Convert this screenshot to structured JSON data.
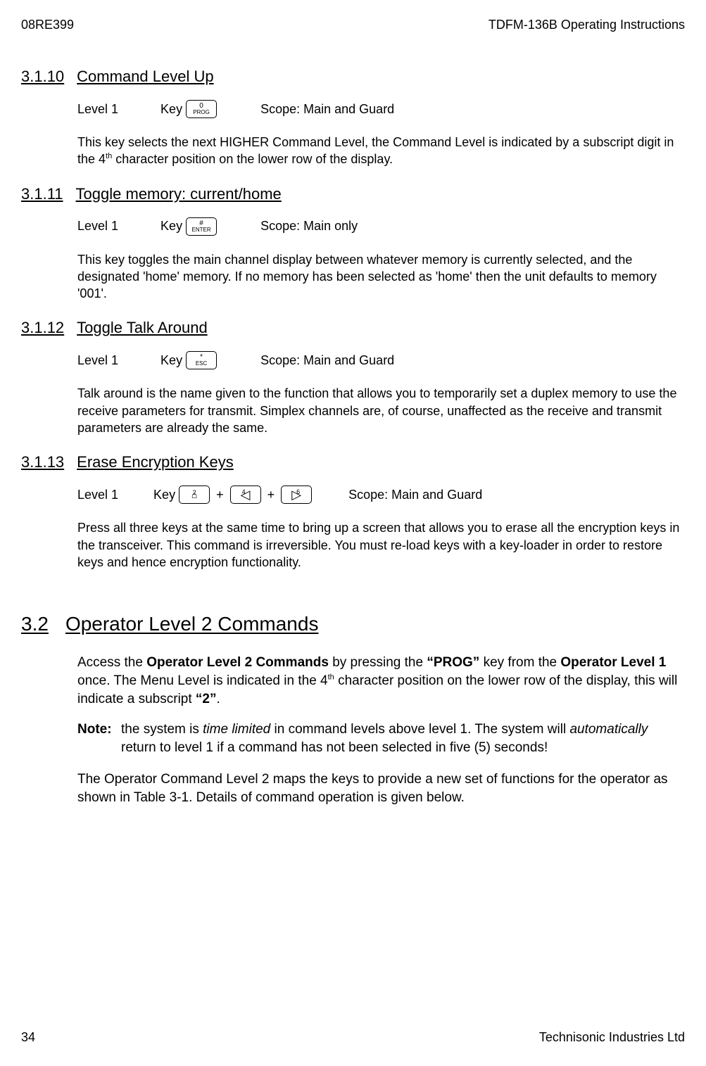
{
  "header": {
    "left": "08RE399",
    "right": "TDFM-136B Operating Instructions"
  },
  "s3110": {
    "num": "3.1.10",
    "title": "Command Level Up",
    "level": "Level 1",
    "key_label": "Key",
    "key_top": "0",
    "key_bot": "PROG",
    "scope_label": "Scope: Main and Guard",
    "body_a": "This key selects the next HIGHER Command Level, the Command Level is indicated by a subscript digit in the 4",
    "body_sup": "th",
    "body_b": " character position on the lower row of the display."
  },
  "s3111": {
    "num": "3.1.11",
    "title": "Toggle memory: current/home",
    "level": "Level 1",
    "key_label": "Key",
    "key_top": "#",
    "key_bot": "ENTER",
    "scope_label": "Scope: Main only",
    "body": "This key toggles the main channel display between whatever memory is currently selected, and the designated 'home' memory.  If no memory has been selected as 'home' then the unit defaults to memory '001'."
  },
  "s3112": {
    "num": "3.1.12",
    "title": "Toggle Talk Around",
    "level": "Level 1",
    "key_label": "Key",
    "key_top": "*",
    "key_bot": "ESC",
    "scope_label": "Scope: Main and Guard",
    "body": "Talk around is the name given to the function that allows you to temporarily set a duplex memory to use the receive parameters for transmit.  Simplex channels are, of course, unaffected as the receive and transmit parameters are already the same."
  },
  "s3113": {
    "num": "3.1.13",
    "title": "Erase Encryption Keys",
    "level": "Level 1",
    "key_label": "Key",
    "k1": "2",
    "k2": "4",
    "k3": "6",
    "plus": "+",
    "scope_label": "Scope: Main and Guard",
    "body": "Press all three keys at the same time to bring up a screen that allows you to erase all the encryption keys in the transceiver.  This command is irreversible.  You must re-load keys with a key-loader in order to restore keys and hence encryption functionality."
  },
  "s32": {
    "num": "3.2",
    "title": "Operator Level 2 Commands",
    "p1_a": "Access the ",
    "p1_b": "Operator Level 2 Commands",
    "p1_c": " by pressing the ",
    "p1_d": "“PROG”",
    "p1_e": " key from the ",
    "p1_f": "Operator Level 1",
    "p1_g": " once. The Menu Level is indicated in the 4",
    "p1_sup": "th",
    "p1_h": " character position on the lower row of the display, this will indicate a subscript ",
    "p1_i": "“2”",
    "p1_j": ".",
    "note_label": "Note:",
    "note_a": "the system is ",
    "note_em1": "time limited",
    "note_b": " in command levels above level 1.  The system will ",
    "note_em2": "automatically",
    "note_c": " return to level 1 if a command has not been selected in five (5) seconds!",
    "p2": "The Operator Command Level 2 maps the keys to provide a new set of functions for the operator as shown in Table 3-1.  Details of command operation is given below."
  },
  "footer": {
    "left": "34",
    "right": "Technisonic Industries Ltd"
  }
}
